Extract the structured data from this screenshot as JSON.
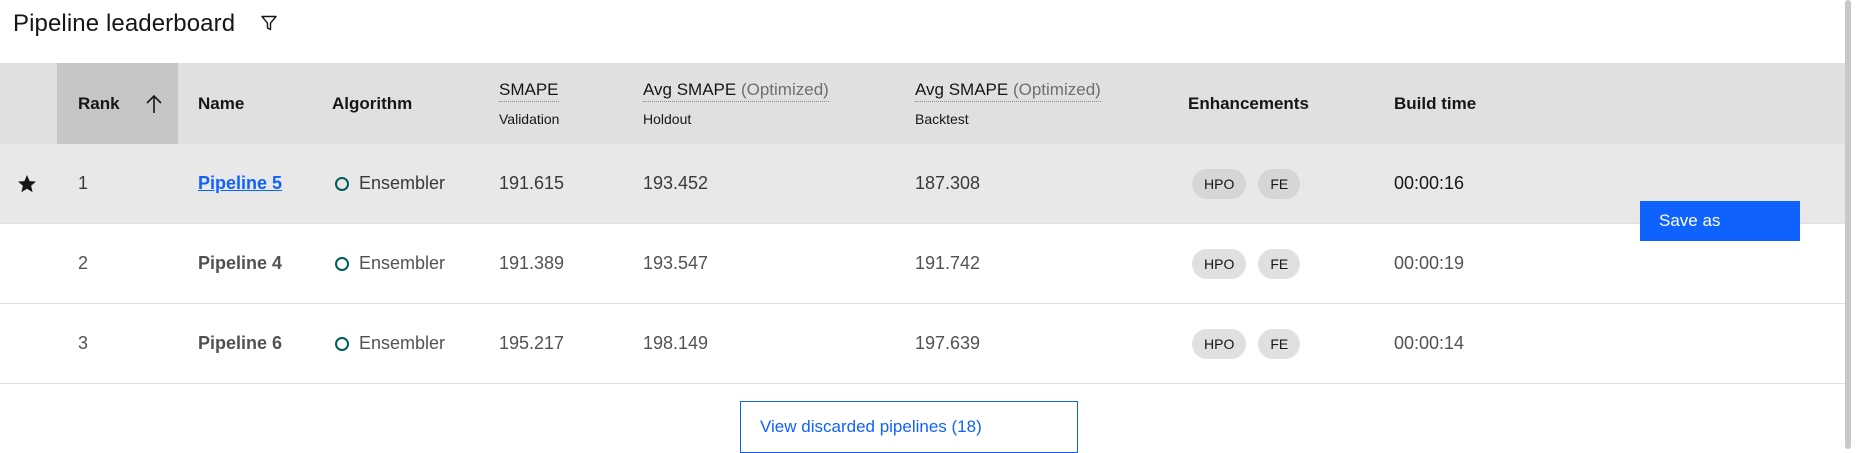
{
  "header": {
    "title": "Pipeline leaderboard",
    "filter_icon": "filter-icon"
  },
  "columns": {
    "rank": "Rank",
    "name": "Name",
    "algorithm": "Algorithm",
    "smape": {
      "label": "SMAPE",
      "sub": "Validation"
    },
    "avg_holdout": {
      "label": "Avg SMAPE",
      "opt": "(Optimized)",
      "sub": "Holdout"
    },
    "avg_backtest": {
      "label": "Avg SMAPE",
      "opt": "(Optimized)",
      "sub": "Backtest"
    },
    "enhancements": "Enhancements",
    "build_time": "Build time",
    "sort_icon": "arrow-up-icon"
  },
  "rows": [
    {
      "starred": true,
      "rank": "1",
      "name": "Pipeline 5",
      "algorithm": "Ensembler",
      "smape": "191.615",
      "holdout": "193.452",
      "backtest": "187.308",
      "tags": [
        "HPO",
        "FE"
      ],
      "build_time": "00:00:16"
    },
    {
      "starred": false,
      "rank": "2",
      "name": "Pipeline 4",
      "algorithm": "Ensembler",
      "smape": "191.389",
      "holdout": "193.547",
      "backtest": "191.742",
      "tags": [
        "HPO",
        "FE"
      ],
      "build_time": "00:00:19"
    },
    {
      "starred": false,
      "rank": "3",
      "name": "Pipeline 6",
      "algorithm": "Ensembler",
      "smape": "195.217",
      "holdout": "198.149",
      "backtest": "197.639",
      "tags": [
        "HPO",
        "FE"
      ],
      "build_time": "00:00:14"
    }
  ],
  "actions": {
    "save_as": "Save as",
    "view_discarded": "View discarded pipelines (18)"
  },
  "colors": {
    "primary": "#0f62fe",
    "header_bg": "#e0e0e0",
    "sorted_header_bg": "#c6c6c6",
    "selected_row_bg": "#e8e8e8",
    "algorithm_ring": "#005d5d"
  }
}
